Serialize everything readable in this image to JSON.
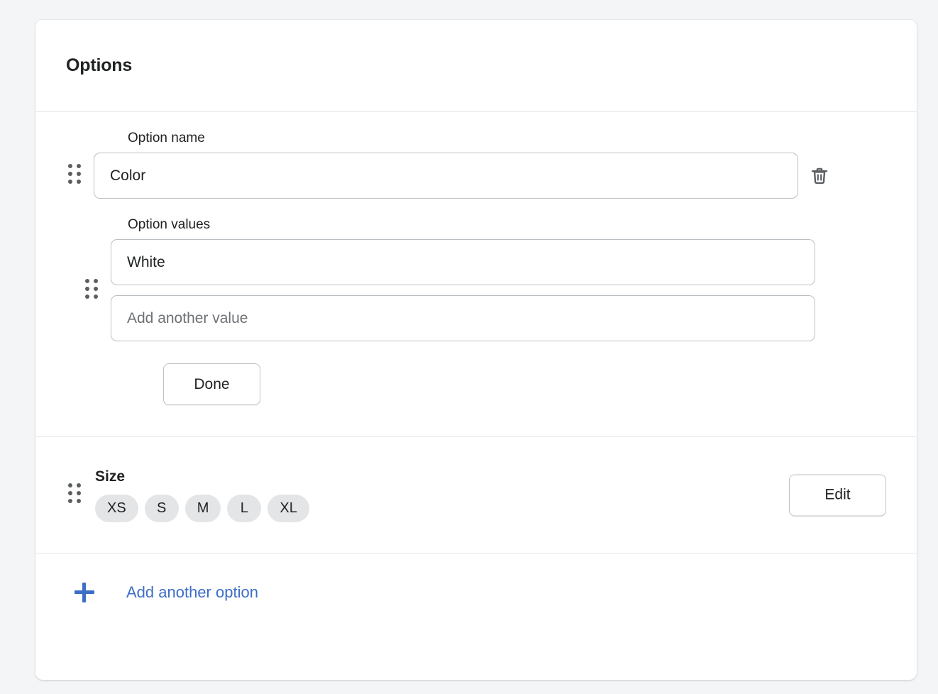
{
  "card": {
    "title": "Options"
  },
  "editing_option": {
    "name_label": "Option name",
    "name_value": "Color",
    "name_placeholder": "",
    "values_label": "Option values",
    "values": [
      {
        "value": "White",
        "placeholder": ""
      },
      {
        "value": "",
        "placeholder": "Add another value"
      }
    ],
    "done_label": "Done",
    "delete_icon": "trash-icon",
    "drag_icon": "drag-handle-icon"
  },
  "saved_option": {
    "title": "Size",
    "badges": [
      "XS",
      "S",
      "M",
      "L",
      "XL"
    ],
    "edit_label": "Edit",
    "drag_icon": "drag-handle-icon"
  },
  "add_option": {
    "label": "Add another option",
    "icon": "plus-icon"
  },
  "colors": {
    "page_background": "#f4f5f7",
    "card_background": "#ffffff",
    "text_primary": "#202223",
    "text_subdued": "#6d7175",
    "border": "#babfc4",
    "divider": "#e6e6e8",
    "badge_background": "#e4e5e7",
    "link_blue": "#3d6ec7",
    "handle_dot": "#5c5f62"
  }
}
